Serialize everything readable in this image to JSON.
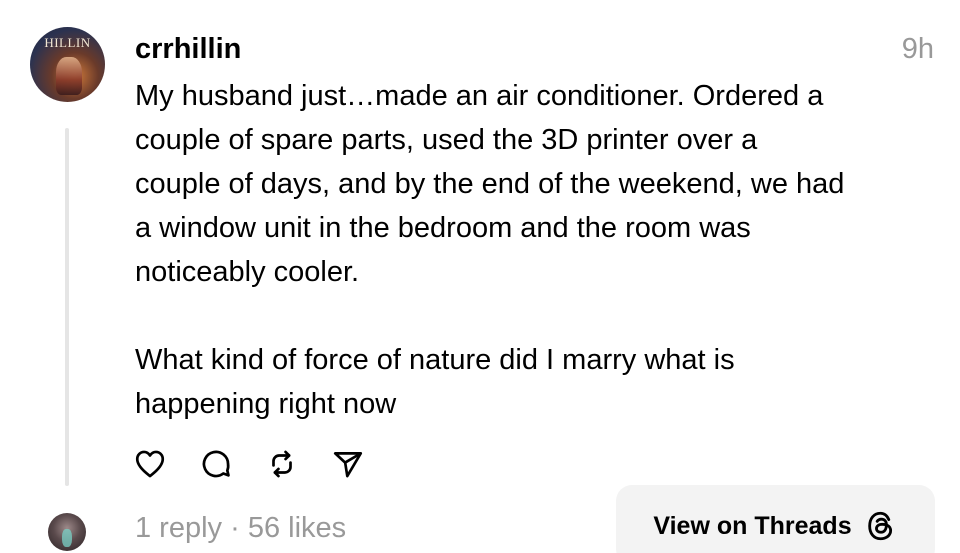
{
  "post": {
    "avatar_text": "HILLIN",
    "username": "crrhillin",
    "time": "9h",
    "paragraphs": [
      "My husband just…made an air conditioner. Ordered a\ncouple of spare parts, used the 3D printer over a\ncouple of days, and by the end of the weekend, we had\na window unit in the bedroom and the room was\nnoticeably cooler.",
      "What kind of force of nature did I marry what is\nhappening right now"
    ]
  },
  "actions": [
    {
      "icon": "heart-icon"
    },
    {
      "icon": "comment-icon"
    },
    {
      "icon": "repost-icon"
    },
    {
      "icon": "share-icon"
    }
  ],
  "footer": {
    "stats": "1 reply · 56 likes",
    "view_button_label": "View on Threads",
    "view_button_icon": "threads-logo-icon"
  },
  "colors": {
    "muted": "#999999",
    "thread_line": "#e5e5e5",
    "button_bg": "#f3f3f3"
  }
}
